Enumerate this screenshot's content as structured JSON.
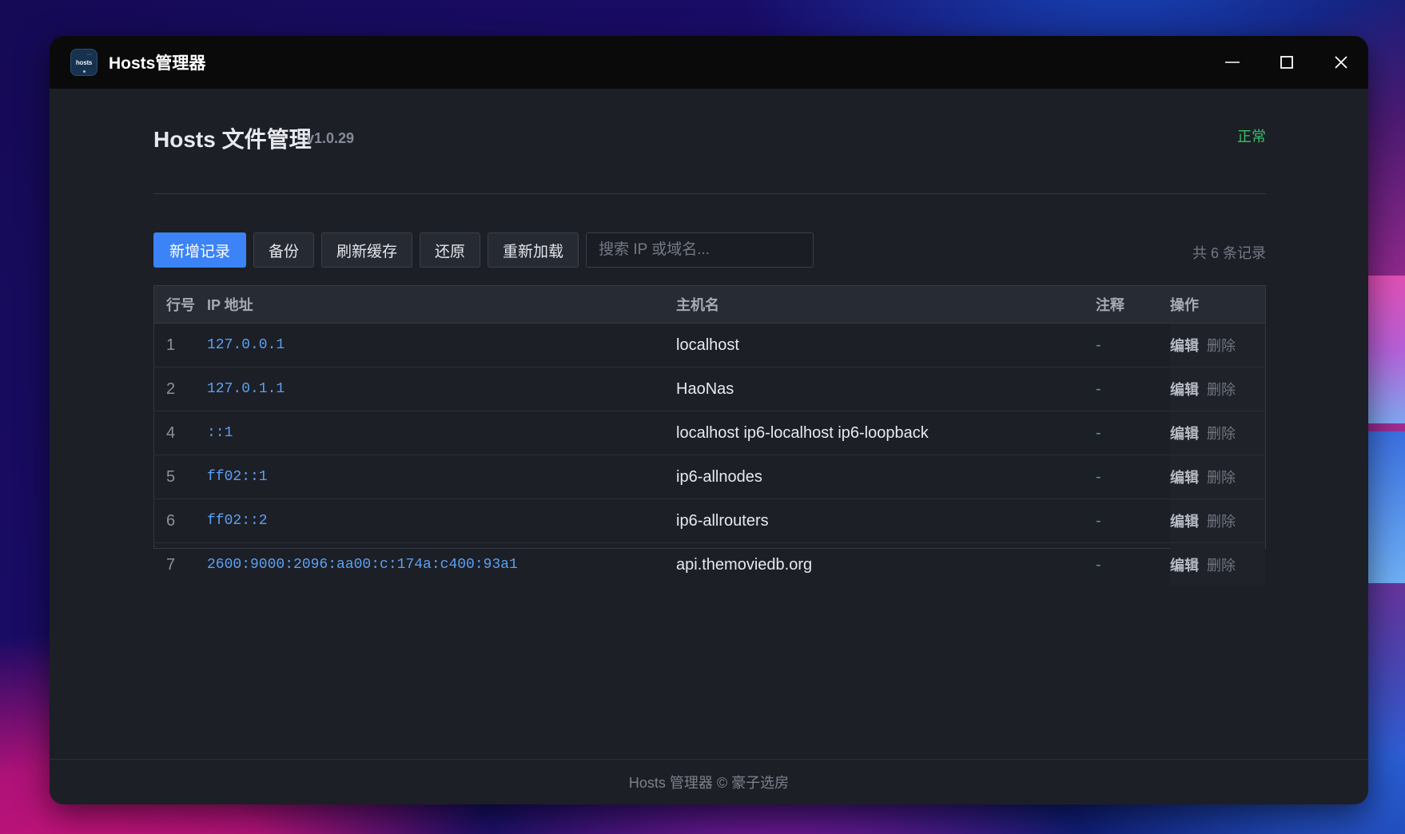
{
  "window": {
    "title": "Hosts管理器",
    "icon_text": "hosts"
  },
  "header": {
    "title": "Hosts 文件管理",
    "version": "v1.0.29",
    "status": "正常"
  },
  "toolbar": {
    "add_label": "新增记录",
    "backup_label": "备份",
    "flush_label": "刷新缓存",
    "restore_label": "还原",
    "reload_label": "重新加载",
    "search_placeholder": "搜索 IP 或域名...",
    "count_text": "共 6 条记录"
  },
  "table": {
    "columns": [
      "行号",
      "IP 地址",
      "主机名",
      "注释",
      "操作"
    ],
    "edit_label": "编辑",
    "delete_label": "删除",
    "rows": [
      {
        "line": "1",
        "ip": "127.0.0.1",
        "host": "localhost",
        "note": "-"
      },
      {
        "line": "2",
        "ip": "127.0.1.1",
        "host": "HaoNas",
        "note": "-"
      },
      {
        "line": "4",
        "ip": "::1",
        "host": "localhost ip6-localhost ip6-loopback",
        "note": "-"
      },
      {
        "line": "5",
        "ip": "ff02::1",
        "host": "ip6-allnodes",
        "note": "-"
      },
      {
        "line": "6",
        "ip": "ff02::2",
        "host": "ip6-allrouters",
        "note": "-"
      },
      {
        "line": "7",
        "ip": "2600:9000:2096:aa00:c:174a:c400:93a1",
        "host": "api.themoviedb.org",
        "note": "-"
      }
    ]
  },
  "footer": {
    "text": "Hosts 管理器 © 豪子选房"
  },
  "colors": {
    "accent": "#3b83f6",
    "status_ok": "#3fbe6a",
    "ip_text": "#5ca0f2"
  }
}
